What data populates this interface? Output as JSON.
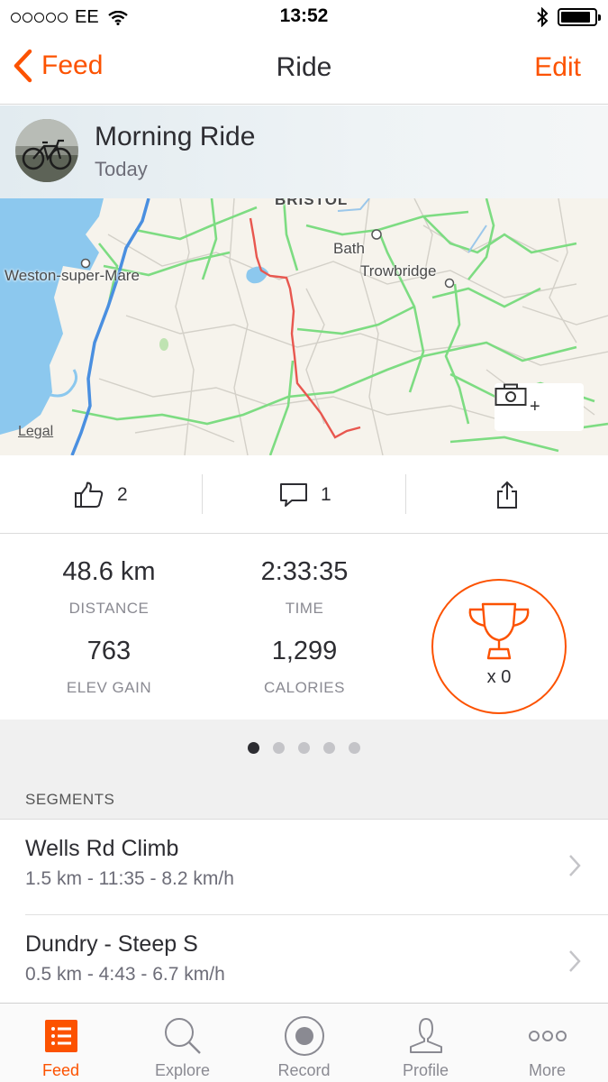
{
  "status_bar": {
    "carrier": "EE",
    "time": "13:52",
    "battery_level": 0.9
  },
  "nav": {
    "back_label": "Feed",
    "title": "Ride",
    "edit_label": "Edit"
  },
  "activity": {
    "title": "Morning Ride",
    "date": "Today"
  },
  "map": {
    "labels": {
      "bristol": "BRISTOL",
      "bath": "Bath",
      "trowbridge": "Trowbridge",
      "weston": "Weston-super-Mare"
    },
    "legal": "Legal",
    "photo_plus": "+"
  },
  "social": {
    "kudos_count": "2",
    "comments_count": "1"
  },
  "stats": {
    "distance": {
      "value": "48.6 km",
      "label": "DISTANCE"
    },
    "time": {
      "value": "2:33:35",
      "label": "TIME"
    },
    "elev_gain": {
      "value": "763",
      "label": "ELEV GAIN"
    },
    "calories": {
      "value": "1,299",
      "label": "CALORIES"
    },
    "achievements": "x 0"
  },
  "pager": {
    "count": 5,
    "active": 0
  },
  "segments": {
    "header": "SEGMENTS",
    "items": [
      {
        "name": "Wells Rd Climb",
        "meta": "1.5 km - 11:35 - 8.2 km/h"
      },
      {
        "name": "Dundry - Steep S",
        "meta": "0.5 km - 4:43 - 6.7 km/h"
      }
    ]
  },
  "tabs": [
    {
      "label": "Feed",
      "icon": "feed-icon",
      "active": true
    },
    {
      "label": "Explore",
      "icon": "search-icon",
      "active": false
    },
    {
      "label": "Record",
      "icon": "record-icon",
      "active": false
    },
    {
      "label": "Profile",
      "icon": "profile-icon",
      "active": false
    },
    {
      "label": "More",
      "icon": "more-icon",
      "active": false
    }
  ],
  "colors": {
    "accent": "#fc5200",
    "route": "#e8574f",
    "roads_green": "#7ddc82",
    "motorway_blue": "#4a8fe0",
    "sea": "#8cc8ee"
  }
}
